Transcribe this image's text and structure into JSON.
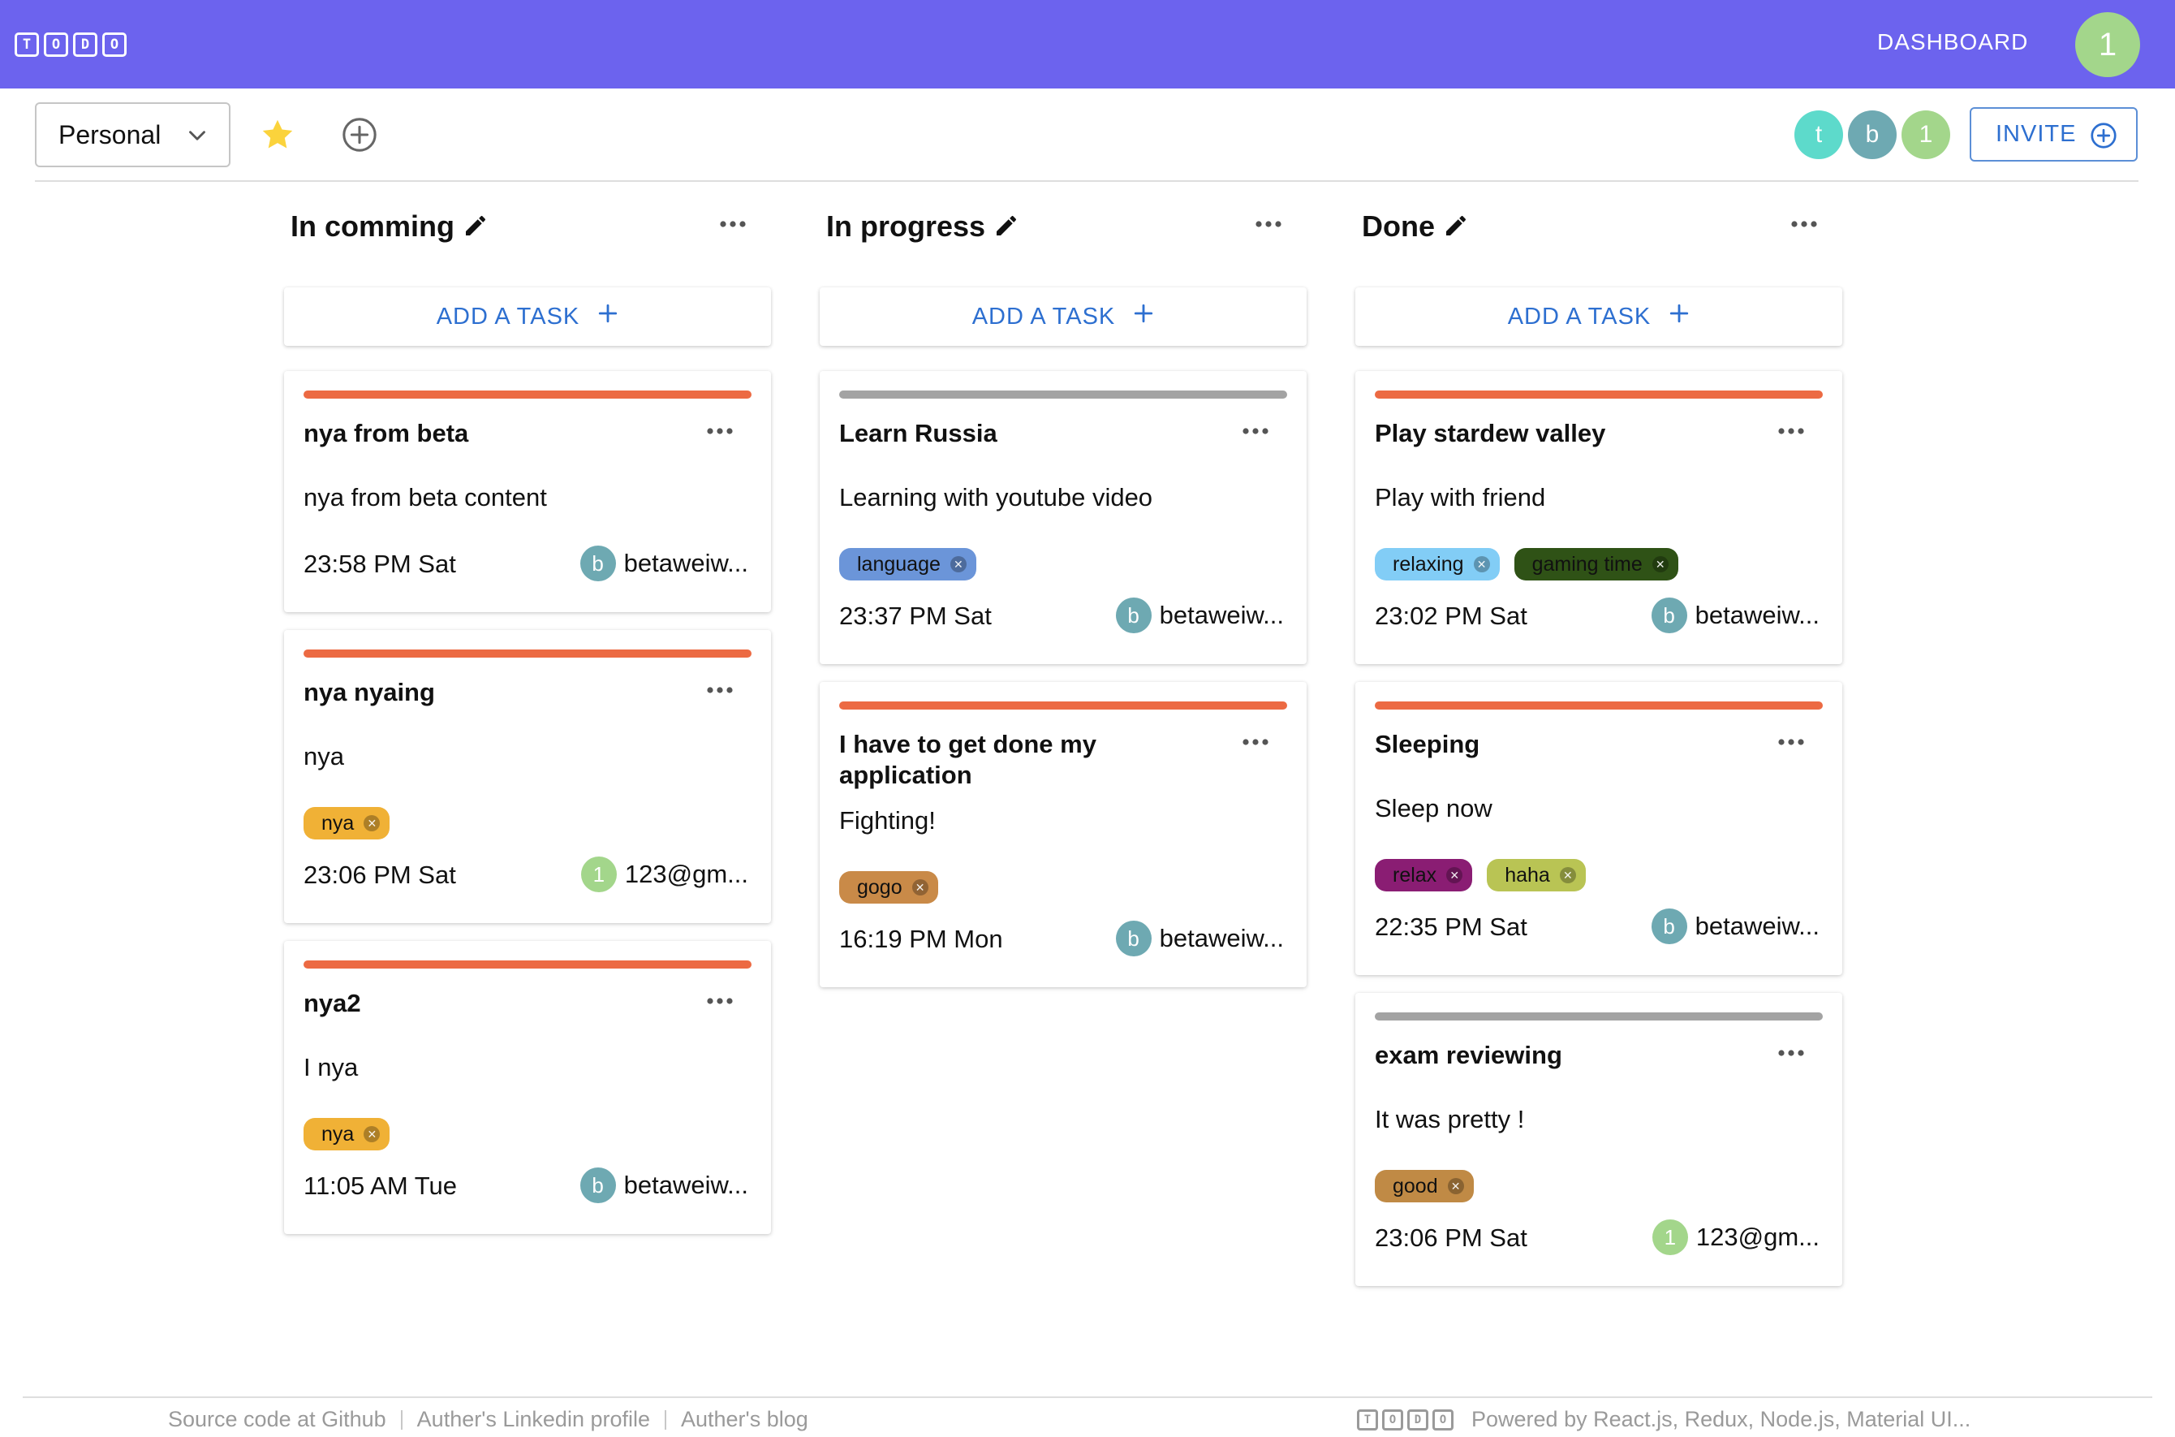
{
  "appbar": {
    "logo_letters": [
      "T",
      "O",
      "D",
      "O"
    ],
    "dashboard_label": "DASHBOARD",
    "user_initial": "1",
    "brand_color": "#6c63ee"
  },
  "toolbar": {
    "board_name": "Personal",
    "invite_label": "INVITE",
    "members": [
      {
        "initial": "t",
        "color": "#5ddacb"
      },
      {
        "initial": "b",
        "color": "#6ea9b2"
      },
      {
        "initial": "1",
        "color": "#a3d68b"
      }
    ]
  },
  "add_task_label": "ADD A TASK",
  "columns": [
    {
      "title": "In comming",
      "cards": [
        {
          "title": "nya from beta",
          "content": "nya from beta content",
          "bar_color": "#ec6a43",
          "tags": [],
          "time": "23:58 PM Sat",
          "assignee": {
            "initial": "b",
            "name": "betaweiw...",
            "color": "#6ea9b2"
          }
        },
        {
          "title": "nya nyaing",
          "content": "nya",
          "bar_color": "#ec6a43",
          "tags": [
            {
              "label": "nya",
              "color": "#f0b136"
            }
          ],
          "time": "23:06 PM Sat",
          "assignee": {
            "initial": "1",
            "name": "123@gm...",
            "color": "#a3d68b"
          }
        },
        {
          "title": "nya2",
          "content": "I nya",
          "bar_color": "#ec6a43",
          "tags": [
            {
              "label": "nya",
              "color": "#f0b136"
            }
          ],
          "time": "11:05 AM Tue",
          "assignee": {
            "initial": "b",
            "name": "betaweiw...",
            "color": "#6ea9b2"
          }
        }
      ]
    },
    {
      "title": "In progress",
      "cards": [
        {
          "title": "Learn Russia",
          "content": "Learning with youtube video",
          "bar_color": "#a3a3a3",
          "tags": [
            {
              "label": "language",
              "color": "#6b95d9"
            }
          ],
          "time": "23:37 PM Sat",
          "assignee": {
            "initial": "b",
            "name": "betaweiw...",
            "color": "#6ea9b2"
          }
        },
        {
          "title": "I have to get done my application",
          "content": "Fighting!",
          "bar_color": "#ec6a43",
          "tags": [
            {
              "label": "gogo",
              "color": "#c98a48"
            }
          ],
          "time": "16:19 PM Mon",
          "assignee": {
            "initial": "b",
            "name": "betaweiw...",
            "color": "#6ea9b2"
          }
        }
      ]
    },
    {
      "title": "Done",
      "cards": [
        {
          "title": "Play stardew valley",
          "content": "Play with friend",
          "bar_color": "#ec6a43",
          "tags": [
            {
              "label": "relaxing",
              "color": "#82cdf6"
            },
            {
              "label": "gaming time",
              "color": "#2f5216"
            }
          ],
          "time": "23:02 PM Sat",
          "assignee": {
            "initial": "b",
            "name": "betaweiw...",
            "color": "#6ea9b2"
          }
        },
        {
          "title": "Sleeping",
          "content": "Sleep now",
          "bar_color": "#ec6a43",
          "tags": [
            {
              "label": "relax",
              "color": "#8a1d73"
            },
            {
              "label": "haha",
              "color": "#b9c454"
            }
          ],
          "time": "22:35 PM Sat",
          "assignee": {
            "initial": "b",
            "name": "betaweiw...",
            "color": "#6ea9b2"
          }
        },
        {
          "title": "exam reviewing",
          "content": "It was pretty !",
          "bar_color": "#a3a3a3",
          "tags": [
            {
              "label": "good",
              "color": "#c08a45"
            }
          ],
          "time": "23:06 PM Sat",
          "assignee": {
            "initial": "1",
            "name": "123@gm...",
            "color": "#a3d68b"
          }
        }
      ]
    }
  ],
  "footer": {
    "links": [
      "Source code at Github",
      "Auther's Linkedin profile",
      "Auther's blog"
    ],
    "powered_by": "Powered by React.js, Redux, Node.js, Material UI..."
  }
}
